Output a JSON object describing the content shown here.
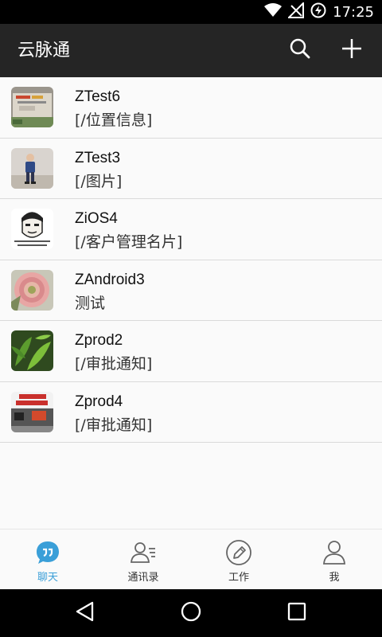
{
  "status_bar": {
    "time": "17:25",
    "icons": [
      "wifi-icon",
      "no-signal-icon",
      "data-saver-icon"
    ]
  },
  "app_bar": {
    "title": "云脉通",
    "search_icon": "search-icon",
    "add_icon": "plus-icon"
  },
  "chats": [
    {
      "name": "ZTest6",
      "message": "[/位置信息]",
      "avatar": "photo-sign"
    },
    {
      "name": "ZTest3",
      "message": "[/图片]",
      "avatar": "photo-child"
    },
    {
      "name": "ZiOS4",
      "message": "[/客户管理名片]",
      "avatar": "meme-face"
    },
    {
      "name": "ZAndroid3",
      "message": "测试",
      "avatar": "photo-flower"
    },
    {
      "name": "Zprod2",
      "message": "[/审批通知]",
      "avatar": "photo-plant"
    },
    {
      "name": "Zprod4",
      "message": "[/审批通知]",
      "avatar": "photo-poster"
    }
  ],
  "tabs": [
    {
      "label": "聊天",
      "icon": "chat-bubble-icon",
      "active": true
    },
    {
      "label": "通讯录",
      "icon": "contacts-icon",
      "active": false
    },
    {
      "label": "工作",
      "icon": "pencil-icon",
      "active": false
    },
    {
      "label": "我",
      "icon": "person-icon",
      "active": false
    }
  ],
  "colors": {
    "accent": "#3a9fd8",
    "app_bar": "#252525",
    "status_bar": "#000000"
  }
}
